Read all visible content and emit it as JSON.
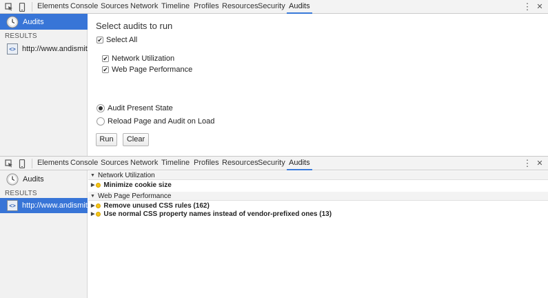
{
  "toolbar": {
    "tabs": [
      "Elements",
      "Console",
      "Sources",
      "Network",
      "Timeline",
      "Profiles",
      "Resources",
      "Security",
      "Audits"
    ],
    "active_tab": "Audits",
    "right_icons": [
      "more-options-icon",
      "close-icon"
    ],
    "left_icons": [
      "inspect-element-icon",
      "device-mode-icon"
    ],
    "more_glyph": "⋮",
    "close_glyph": "✕"
  },
  "top": {
    "sidebar": {
      "audits_label": "Audits",
      "results_header": "RESULTS",
      "result_url": "http://www.andismith.com"
    },
    "heading": "Select audits to run",
    "select_all_label": "Select All",
    "audit_options": [
      "Network Utilization",
      "Web Page Performance"
    ],
    "mode_options": [
      "Audit Present State",
      "Reload Page and Audit on Load"
    ],
    "selected_mode": "Audit Present State",
    "run_label": "Run",
    "clear_label": "Clear",
    "check_glyph": "✔"
  },
  "bottom": {
    "sidebar": {
      "audits_label": "Audits",
      "results_header": "RESULTS",
      "result_url": "http://www.andismith.com"
    },
    "sections": [
      {
        "title": "Network Utilization",
        "items": [
          "Minimize cookie size"
        ]
      },
      {
        "title": "Web Page Performance",
        "items": [
          "Remove unused CSS rules (162)",
          "Use normal CSS property names instead of vendor-prefixed ones (13)"
        ]
      }
    ]
  },
  "colors": {
    "accent": "#3875d7",
    "tab_underline": "#3879d9",
    "warning": "#f5c518"
  }
}
